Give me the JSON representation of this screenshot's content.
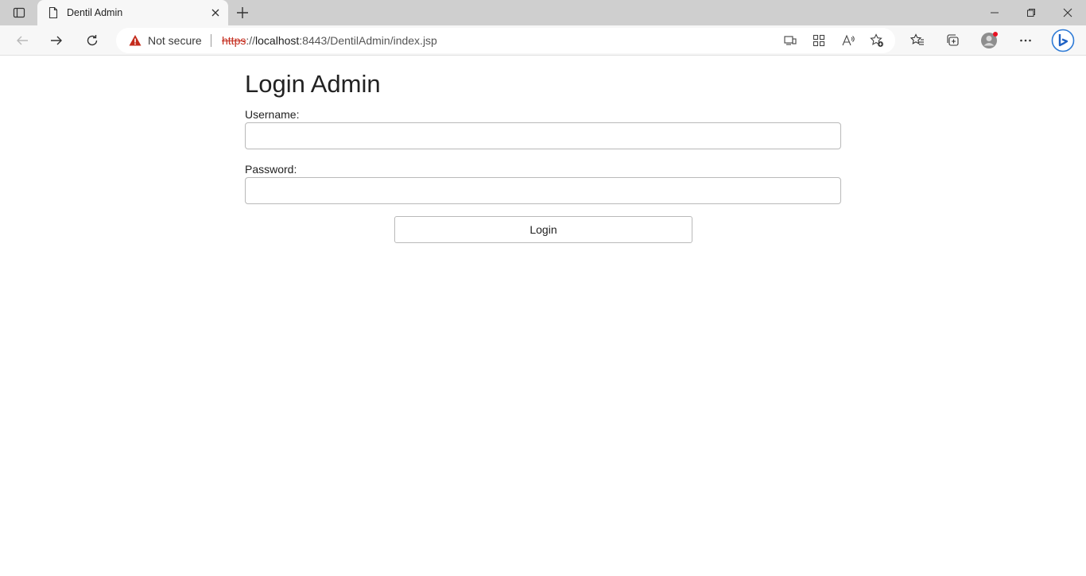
{
  "browser": {
    "tab": {
      "title": "Dentil Admin"
    },
    "address": {
      "security_label": "Not secure",
      "url_protocol": "https",
      "url_separator": "://",
      "url_host": "localhost",
      "url_rest": ":8443/DentilAdmin/index.jsp"
    },
    "icons": {
      "tab_actions": "tab-actions-icon",
      "favicon": "document-icon",
      "close": "close-icon",
      "new_tab": "plus-icon",
      "back": "back-arrow-icon",
      "forward": "forward-arrow-icon",
      "refresh": "refresh-icon",
      "warning": "warning-icon",
      "profile": "avatar-icon",
      "copilot": "bing-copilot-icon"
    },
    "colors": {
      "warning": "#c42b1c",
      "tabstrip": "#cfcfcf",
      "toolbar": "#f7f7f7",
      "profile_dot": "#e81123"
    }
  },
  "page": {
    "title": "Login Admin",
    "username_label": "Username:",
    "username_value": "",
    "password_label": "Password:",
    "password_value": "",
    "login_label": "Login"
  }
}
